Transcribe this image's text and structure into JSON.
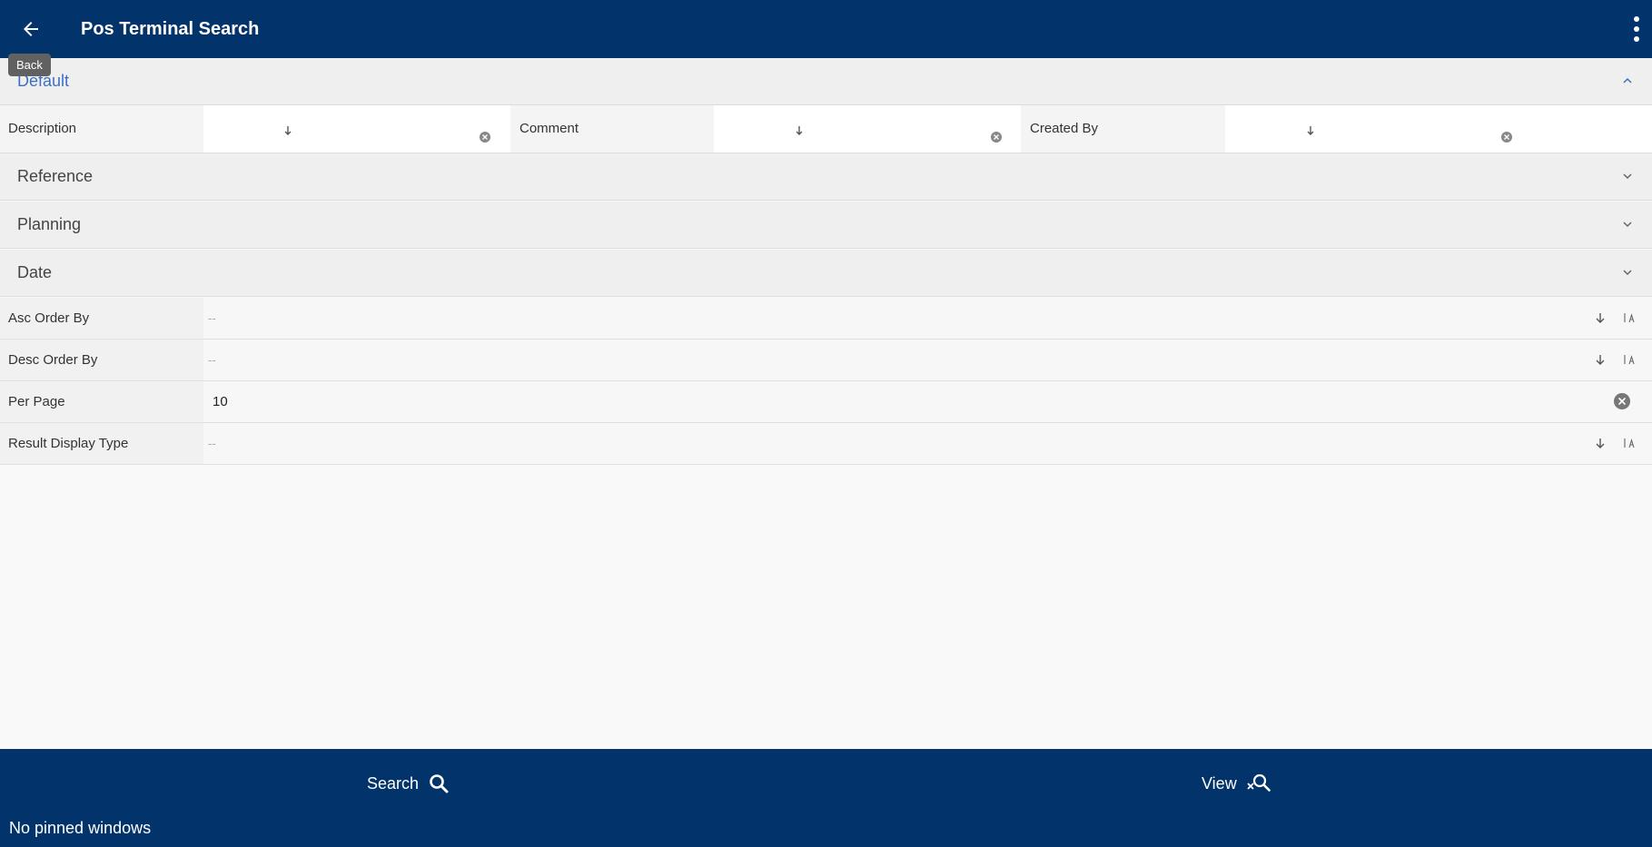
{
  "header": {
    "title": "Pos Terminal Search",
    "back_tooltip": "Back"
  },
  "sections": {
    "default": "Default",
    "reference": "Reference",
    "planning": "Planning",
    "date": "Date"
  },
  "filters": [
    {
      "label": "Description",
      "value": ""
    },
    {
      "label": "Comment",
      "value": ""
    },
    {
      "label": "Created By",
      "value": ""
    }
  ],
  "params": {
    "asc_order_by": {
      "label": "Asc Order By",
      "placeholder": "--"
    },
    "desc_order_by": {
      "label": "Desc Order By",
      "placeholder": "--"
    },
    "per_page": {
      "label": "Per Page",
      "value": "10"
    },
    "result_display_type": {
      "label": "Result Display Type",
      "placeholder": "--"
    }
  },
  "footer": {
    "search_label": "Search",
    "view_label": "View",
    "pinned_text": "No pinned windows"
  },
  "colors": {
    "primary": "#02336b",
    "active_section": "#3f6fc4"
  }
}
